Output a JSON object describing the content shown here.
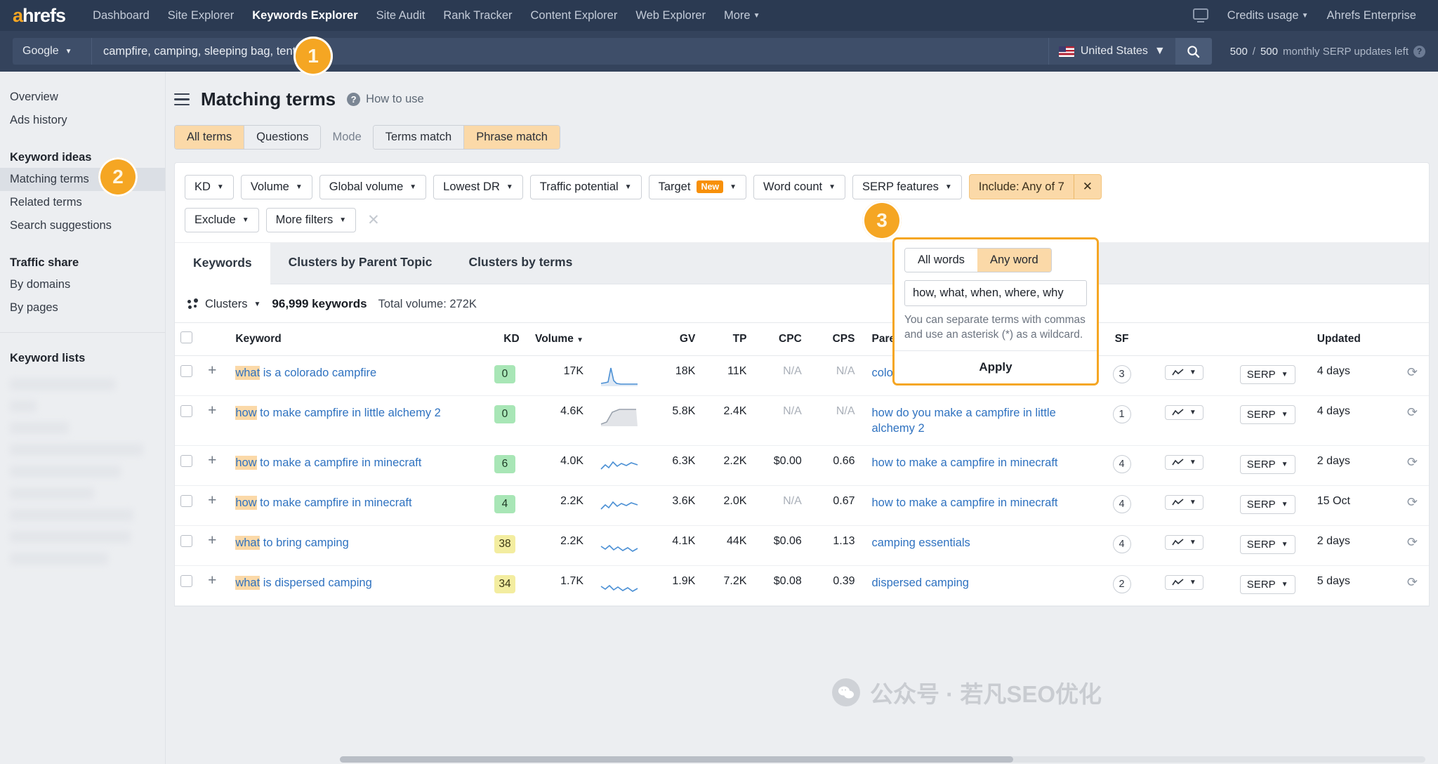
{
  "topnav": {
    "logo": "ahrefs",
    "links": [
      {
        "label": "Dashboard",
        "active": false
      },
      {
        "label": "Site Explorer",
        "active": false
      },
      {
        "label": "Keywords Explorer",
        "active": true
      },
      {
        "label": "Site Audit",
        "active": false
      },
      {
        "label": "Rank Tracker",
        "active": false
      },
      {
        "label": "Content Explorer",
        "active": false
      },
      {
        "label": "Web Explorer",
        "active": false
      },
      {
        "label": "More",
        "active": false,
        "caret": true
      }
    ],
    "credits_label": "Credits usage",
    "account_label": "Ahrefs Enterprise"
  },
  "searchbar": {
    "engine": "Google",
    "keywords_value": "campfire, camping, sleeping bag, tent",
    "country": "United States",
    "serp_used": "500",
    "serp_total": "500",
    "serp_text": "monthly SERP updates left"
  },
  "sidebar": {
    "items_top": [
      {
        "label": "Overview",
        "active": false
      },
      {
        "label": "Ads history",
        "active": false
      }
    ],
    "keyword_ideas_head": "Keyword ideas",
    "keyword_ideas": [
      {
        "label": "Matching terms",
        "active": true
      },
      {
        "label": "Related terms",
        "active": false
      },
      {
        "label": "Search suggestions",
        "active": false
      }
    ],
    "traffic_share_head": "Traffic share",
    "traffic_share": [
      {
        "label": "By domains",
        "active": false
      },
      {
        "label": "By pages",
        "active": false
      }
    ],
    "keyword_lists_head": "Keyword lists"
  },
  "main": {
    "title": "Matching terms",
    "how_to_use": "How to use",
    "segments": {
      "terms": [
        {
          "label": "All terms",
          "on": true
        },
        {
          "label": "Questions",
          "on": false
        }
      ],
      "mode_label": "Mode",
      "mode": [
        {
          "label": "Terms match",
          "on": false
        },
        {
          "label": "Phrase match",
          "on": true
        }
      ]
    },
    "filters_row1": [
      {
        "label": "KD"
      },
      {
        "label": "Volume"
      },
      {
        "label": "Global volume"
      },
      {
        "label": "Lowest DR"
      },
      {
        "label": "Traffic potential"
      },
      {
        "label": "Target",
        "badge": "New"
      },
      {
        "label": "Word count"
      },
      {
        "label": "SERP features"
      }
    ],
    "include_chip": "Include: Any of 7",
    "filters_row2": [
      {
        "label": "Exclude"
      },
      {
        "label": "More filters"
      }
    ]
  },
  "popover": {
    "modes": [
      {
        "label": "All words",
        "on": false
      },
      {
        "label": "Any word",
        "on": true
      }
    ],
    "input_value": "how, what, when, where, why",
    "hint": "You can separate terms with commas and use an asterisk (*) as a wildcard.",
    "apply": "Apply"
  },
  "callouts": [
    {
      "n": "1"
    },
    {
      "n": "2"
    },
    {
      "n": "3"
    }
  ],
  "table": {
    "tabs": [
      {
        "label": "Keywords",
        "on": true
      },
      {
        "label": "Clusters by Parent Topic",
        "on": false
      },
      {
        "label": "Clusters by terms",
        "on": false
      }
    ],
    "clusters_label": "Clusters",
    "keyword_count": "96,999 keywords",
    "total_volume": "Total volume: 272K",
    "columns": [
      "Keyword",
      "KD",
      "Volume",
      "GV",
      "TP",
      "CPC",
      "CPS",
      "Parent Topic",
      "SF",
      "Updated"
    ],
    "rows": [
      {
        "highlight": "what",
        "keyword": " is a colorado campfire",
        "kd": "0",
        "kd_tone": "green",
        "volume": "17K",
        "gv": "18K",
        "tp": "11K",
        "cpc": "N/A",
        "cps": "N/A",
        "parent": "colorado campfire",
        "sf": "3",
        "serp": "SERP",
        "updated": "4 days",
        "spark": "spike"
      },
      {
        "highlight": "how",
        "keyword": " to make campfire in little alchemy 2",
        "kd": "0",
        "kd_tone": "green",
        "volume": "4.6K",
        "gv": "5.8K",
        "tp": "2.4K",
        "cpc": "N/A",
        "cps": "N/A",
        "parent": "how do you make a campfire in little alchemy 2",
        "sf": "1",
        "serp": "SERP",
        "updated": "4 days",
        "spark": "hump"
      },
      {
        "highlight": "how",
        "keyword": " to make a campfire in minecraft",
        "kd": "6",
        "kd_tone": "green",
        "volume": "4.0K",
        "gv": "6.3K",
        "tp": "2.2K",
        "cpc": "$0.00",
        "cps": "0.66",
        "parent": "how to make a campfire in minecraft",
        "sf": "4",
        "serp": "SERP",
        "updated": "2 days",
        "spark": "wave"
      },
      {
        "highlight": "how",
        "keyword": " to make campfire in minecraft",
        "kd": "4",
        "kd_tone": "green",
        "volume": "2.2K",
        "gv": "3.6K",
        "tp": "2.0K",
        "cpc": "N/A",
        "cps": "0.67",
        "parent": "how to make a campfire in minecraft",
        "sf": "4",
        "serp": "SERP",
        "updated": "15 Oct",
        "spark": "wave"
      },
      {
        "highlight": "what",
        "keyword": " to bring camping",
        "kd": "38",
        "kd_tone": "yellow",
        "volume": "2.2K",
        "gv": "4.1K",
        "tp": "44K",
        "cpc": "$0.06",
        "cps": "1.13",
        "parent": "camping essentials",
        "sf": "4",
        "serp": "SERP",
        "updated": "2 days",
        "spark": "wave2"
      },
      {
        "highlight": "what",
        "keyword": " is dispersed camping",
        "kd": "34",
        "kd_tone": "yellow",
        "volume": "1.7K",
        "gv": "1.9K",
        "tp": "7.2K",
        "cpc": "$0.08",
        "cps": "0.39",
        "parent": "dispersed camping",
        "sf": "2",
        "serp": "SERP",
        "updated": "5 days",
        "spark": "wave2"
      }
    ]
  },
  "watermark": {
    "text": "公众号 · 若凡SEO优化"
  }
}
